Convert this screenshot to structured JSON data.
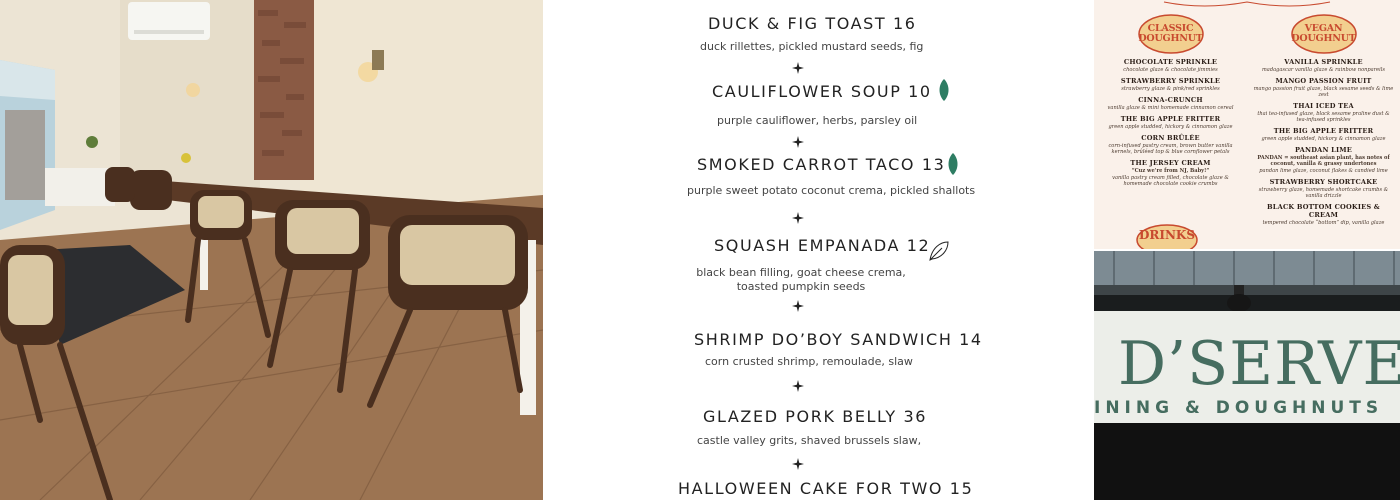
{
  "menu": {
    "dishes": [
      {
        "title": "DUCK & FIG TOAST 16",
        "description": "duck rillettes, pickled mustard seeds, fig",
        "icon": ""
      },
      {
        "title": "CAULIFLOWER SOUP 10",
        "description": "purple cauliflower, herbs, parsley oil",
        "icon": "leaf-solid-icon"
      },
      {
        "title": "SMOKED CARROT TACO 13",
        "description": "purple sweet potato coconut crema, pickled shallots",
        "icon": "leaf-solid-icon"
      },
      {
        "title": "SQUASH EMPANADA 12",
        "description": "black bean filling, goat cheese crema, toasted pumpkin seeds",
        "icon": "leaf-outline-icon"
      },
      {
        "title": "SHRIMP DO’BOY SANDWICH 14",
        "description": "corn crusted shrimp, remoulade, slaw",
        "icon": ""
      },
      {
        "title": "GLAZED PORK BELLY 36",
        "description": "castle valley grits,  shaved brussels slaw,",
        "icon": ""
      },
      {
        "title": "HALLOWEEN CAKE FOR TWO 15",
        "description": "",
        "icon": ""
      }
    ],
    "leaf_color": "#2e7d63"
  },
  "doughnut_card": {
    "classic": {
      "badge": [
        "CLASSIC",
        "DOUGHNUT"
      ],
      "items": [
        {
          "name": "CHOCOLATE SPRINKLE",
          "desc": "chocolate glaze & chocolate jimmies"
        },
        {
          "name": "STRAWBERRY SPRINKLE",
          "desc": "strawberry glaze & pink/red sprinkles"
        },
        {
          "name": "CINNA-CRUNCH",
          "desc": "vanilla glaze & mini homemade cinnamon cereal"
        },
        {
          "name": "THE BIG APPLE FRITTER",
          "desc": "green apple studded, hickory & cinnamon glaze"
        },
        {
          "name": "CORN BRÛLÉE",
          "desc": "corn-infused pastry cream, brown butter vanilla kernels, brûléed top & blue cornflower petals"
        },
        {
          "name": "THE JERSEY CREAM",
          "desc_lead": "“Cuz we’re from NJ, Baby!”",
          "desc": "vanilla pastry cream filled, chocolate glaze & homemade chocolate cookie crumbs"
        }
      ]
    },
    "vegan": {
      "badge": [
        "VEGAN",
        "DOUGHNUT"
      ],
      "items": [
        {
          "name": "VANILLA SPRINKLE",
          "desc": "madagascar vanilla glaze & rainbow nonpareils"
        },
        {
          "name": "MANGO PASSION FRUIT",
          "desc": "mango passion fruit glaze, black sesame seeds & lime zest"
        },
        {
          "name": "THAI ICED TEA",
          "desc": "thai tea-infused glaze, black sesame praline dust & tea-infused sprinkles"
        },
        {
          "name": "THE BIG APPLE FRITTER",
          "desc": "green apple studded, hickory & cinnamon glaze"
        },
        {
          "name": "PANDAN LIME",
          "desc_lead": "PANDAN = southeast asian plant, has notes of coconut, vanilla & grassy undertones",
          "desc": "pandan lime glaze, coconut flakes & candied lime"
        },
        {
          "name": "STRAWBERRY SHORTCAKE",
          "desc": "strawberry glaze, homemade shortcake crumbs & vanilla drizzle"
        },
        {
          "name": "BLACK BOTTOM COOKIES & CREAM",
          "desc": "tempered chocolate “bottom” dip, vanilla glaze"
        }
      ]
    },
    "drinks": "DRINKS",
    "accent_color": "#c84a2f",
    "badge_fill": "#f2cf8f"
  },
  "storefront": {
    "name": "D’SERVE",
    "subtitle": "INING & DOUGHNUTS",
    "sign_color": "#466d60"
  }
}
